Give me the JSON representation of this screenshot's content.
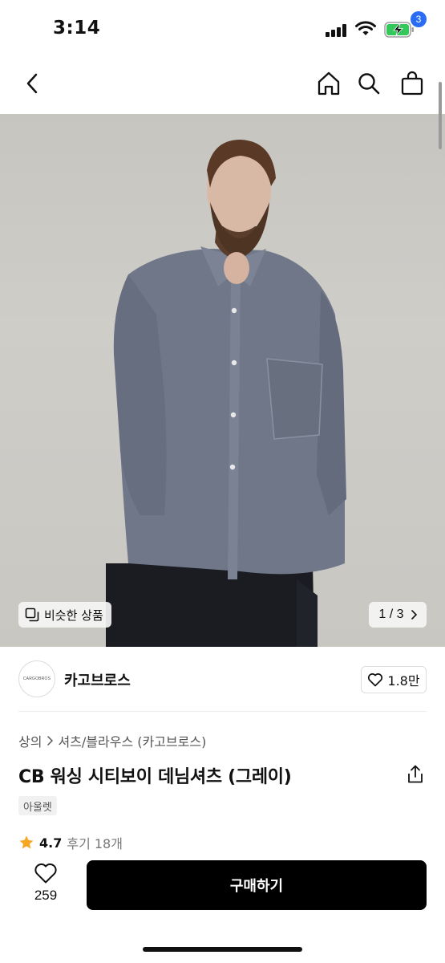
{
  "status_bar": {
    "time": "3:14"
  },
  "nav": {
    "cart_count": "3"
  },
  "product_image": {
    "similar_label": "비슷한 상품",
    "page_indicator": "1 / 3"
  },
  "brand": {
    "logo_text": "CARGOBROS",
    "name": "카고브로스",
    "follower_count": "1.8만"
  },
  "product": {
    "breadcrumb": [
      "상의",
      "셔츠/블라우스 (카고브로스)"
    ],
    "title": "CB 워싱 시티보이 데님셔츠 (그레이)",
    "tag": "아울렛",
    "rating": "4.7",
    "review_label": "후기 18개"
  },
  "bottom_bar": {
    "like_count": "259",
    "buy_label": "구매하기"
  },
  "colors": {
    "accent_badge": "#2a6df4",
    "star": "#f5a623",
    "buy_button": "#000000"
  }
}
